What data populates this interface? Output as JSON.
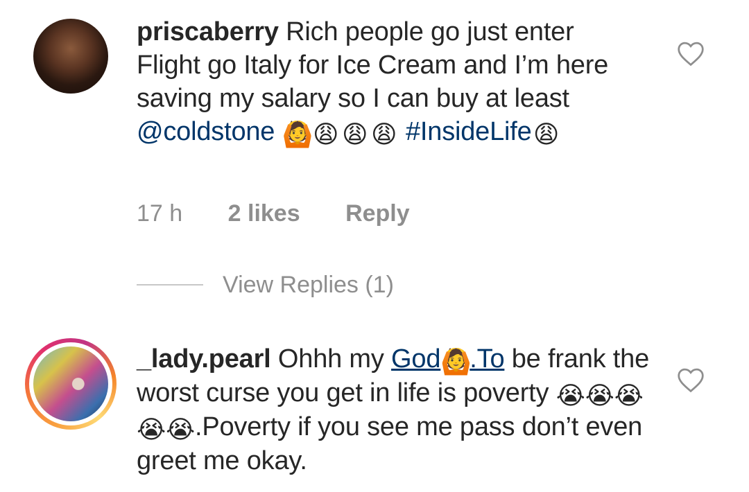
{
  "comments": [
    {
      "username": "priscaberry",
      "text_1": " Rich people go just enter Flight go Italy for Ice Cream and I’m here saving my salary so I can buy at least ",
      "mention": "@coldstone",
      "emoji_a": "🙆",
      "emoji_b": "😩",
      "emoji_c": "😩",
      "emoji_d": "😩",
      "hashtag": "#InsideLife",
      "emoji_e": "😩",
      "time": "17 h",
      "likes": "2 likes",
      "reply_label": "Reply",
      "view_replies": "View Replies (1)"
    },
    {
      "username": "_lady.pearl",
      "text_1": " Ohhh my ",
      "link_1": "God",
      "emoji_a": "🙆",
      "link_2": ".To",
      "text_2": " be frank the worst curse you get in life is poverty ",
      "emoji_b": "😭",
      "emoji_c": "😭",
      "emoji_d": "😭",
      "emoji_e": "😭",
      "emoji_f": "😭",
      "text_3": ".Poverty if you see me pass don’t even greet me okay."
    }
  ],
  "icons": {
    "heart": "heart-icon"
  },
  "colors": {
    "text": "#262626",
    "secondary": "#8e8e8e",
    "link": "#003569"
  }
}
